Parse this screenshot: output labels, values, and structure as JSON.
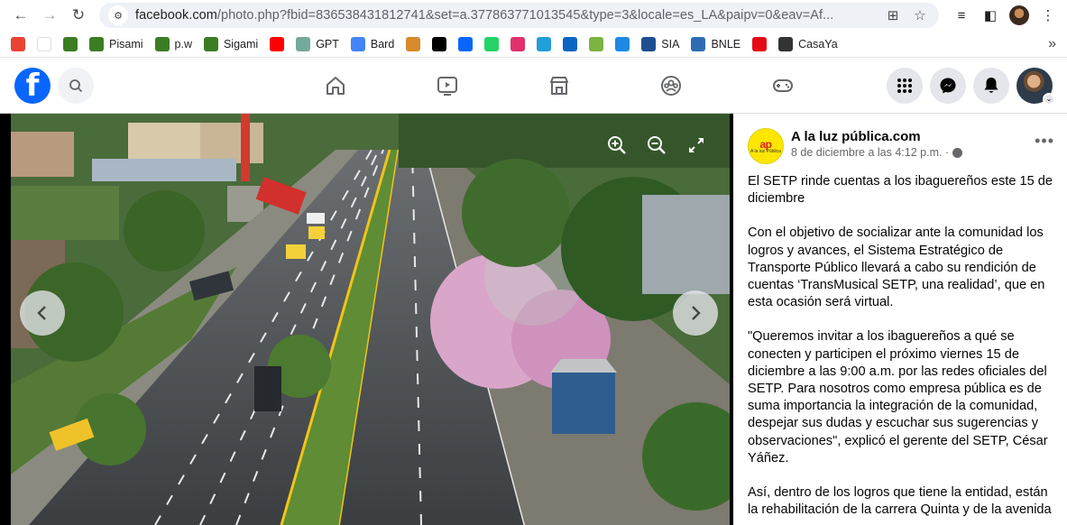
{
  "browser": {
    "url_main": "facebook.com",
    "url_rest": "/photo.php?fbid=836538431812741&set=a.377863771013545&type=3&locale=es_LA&paipv=0&eav=Af..."
  },
  "bookmarks": [
    {
      "label": "",
      "icon": "apps-grid-icon",
      "color": "#ea4335"
    },
    {
      "label": "",
      "icon": "gmail-icon",
      "color": "#ffffff"
    },
    {
      "label": "",
      "icon": "shield-crest-icon",
      "color": "#3b7d23"
    },
    {
      "label": "Pisami",
      "icon": "shield-crest-icon",
      "color": "#3b7d23"
    },
    {
      "label": "p.w",
      "icon": "shield-crest-icon",
      "color": "#3b7d23"
    },
    {
      "label": "Sigami",
      "icon": "shield-crest-icon",
      "color": "#3b7d23"
    },
    {
      "label": "",
      "icon": "youtube-icon",
      "color": "#ff0000"
    },
    {
      "label": "GPT",
      "icon": "chatgpt-icon",
      "color": "#74aa9c"
    },
    {
      "label": "Bard",
      "icon": "bard-sparkle-icon",
      "color": "#4285f4"
    },
    {
      "label": "",
      "icon": "figure-icon",
      "color": "#d88b2c"
    },
    {
      "label": "",
      "icon": "x-icon",
      "color": "#000000"
    },
    {
      "label": "",
      "icon": "facebook-icon",
      "color": "#0866ff"
    },
    {
      "label": "",
      "icon": "whatsapp-icon",
      "color": "#25d366"
    },
    {
      "label": "",
      "icon": "instagram-icon",
      "color": "#e1306c"
    },
    {
      "label": "",
      "icon": "telegram-icon",
      "color": "#229ed9"
    },
    {
      "label": "",
      "icon": "linkedin-icon",
      "color": "#0a66c2"
    },
    {
      "label": "",
      "icon": "leaf-icon",
      "color": "#7cb342"
    },
    {
      "label": "",
      "icon": "bird-icon",
      "color": "#1e88e5"
    },
    {
      "label": "SIA",
      "icon": "six-icon",
      "color": "#1d4f91"
    },
    {
      "label": "BNLE",
      "icon": "bnle-icon",
      "color": "#2e6db4"
    },
    {
      "label": "",
      "icon": "netflix-icon",
      "color": "#e50914"
    },
    {
      "label": "CasaYa",
      "icon": "casaya-icon",
      "color": "#333333"
    }
  ],
  "post": {
    "page_name": "A la luz pública.com",
    "logo_text": "ap",
    "logo_sub": "A la luz Pública",
    "timestamp": "8 de diciembre a las 4:12 p.m. ·",
    "paragraphs": [
      "El SETP rinde cuentas a los ibaguereños este 15 de diciembre",
      "Con el objetivo de socializar ante la comunidad los logros y avances, el Sistema Estratégico de Transporte Público llevará a cabo su rendición de cuentas ‘TransMusical SETP, una realidad’, que en esta ocasión será virtual.",
      "\"Queremos invitar a los ibaguereños a qué se conecten y participen el próximo viernes 15 de diciembre a las 9:00 a.m. por las redes oficiales del SETP. Para nosotros como empresa pública es de suma importancia la integración de la comunidad, despejar sus dudas y escuchar sus sugerencias y observaciones\", explicó el gerente del SETP, César Yáñez.",
      "Así, dentro de los logros que tiene la entidad, están la rehabilitación de la carrera Quinta y de la avenida"
    ]
  },
  "colors": {
    "fb_blue": "#0866ff",
    "header_bg": "#ffffff",
    "photo_bg": "#000000"
  }
}
